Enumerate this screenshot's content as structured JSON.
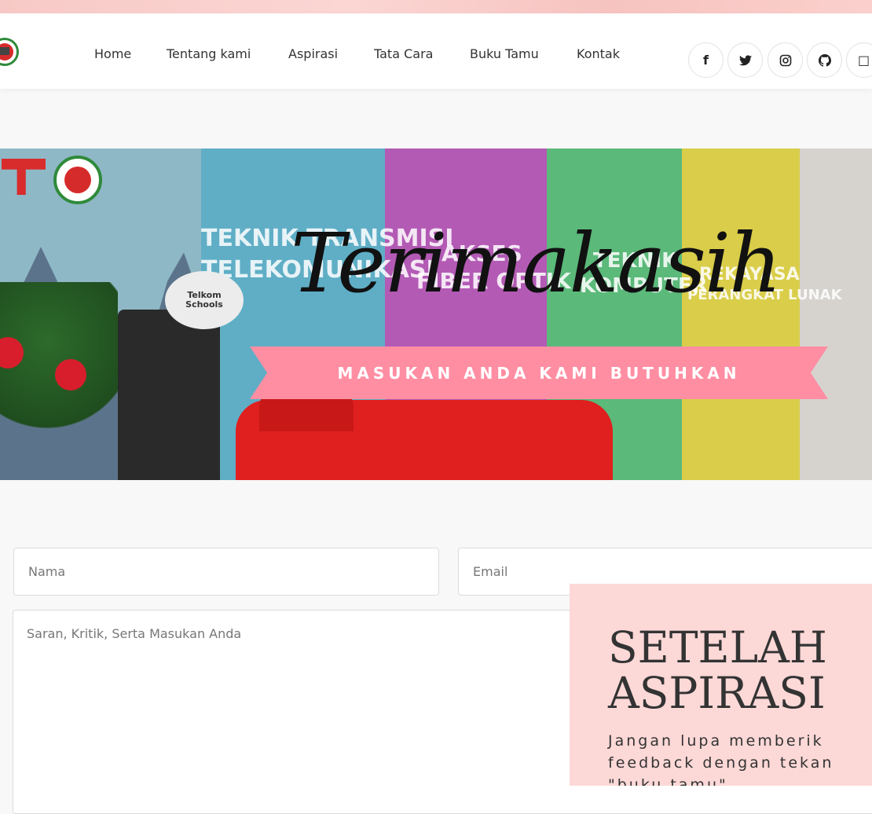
{
  "navbar": {
    "links": [
      "Home",
      "Tentang kami",
      "Aspirasi",
      "Tata Cara",
      "Buku Tamu",
      "Kontak"
    ],
    "social_icons": [
      "facebook-icon",
      "twitter-icon",
      "instagram-icon",
      "github-icon",
      "square-icon"
    ],
    "social_glyphs": [
      "f",
      "✧",
      "◎",
      "⭘",
      "□"
    ]
  },
  "hero": {
    "wall_text": {
      "t1": "TEKNIK TRANSMISI",
      "t2": "TELEKOMUNIKASI",
      "a1": "AKSES",
      "a2": "FIBER OPTIK",
      "k1": "TEKNIK",
      "k2": "KOMPUTER",
      "r1": "REKAYASA",
      "r2": "PERANGKAT LUNAK",
      "podium": "Telkom Schools"
    },
    "script_title": "Terimakasih",
    "ribbon_text": "MASUKAN ANDA KAMI BUTUHKAN"
  },
  "form": {
    "name_placeholder": "Nama",
    "email_placeholder": "Email",
    "message_placeholder": "Saran, Kritik, Serta Masukan Anda"
  },
  "card": {
    "title": "SETELAH ASPIRASI",
    "text": "Jangan lupa memberik feedback dengan tekan \"buku tamu\""
  },
  "colors": {
    "accent_pink": "#fcd8d7",
    "ribbon_pink": "#ff8ea3"
  }
}
